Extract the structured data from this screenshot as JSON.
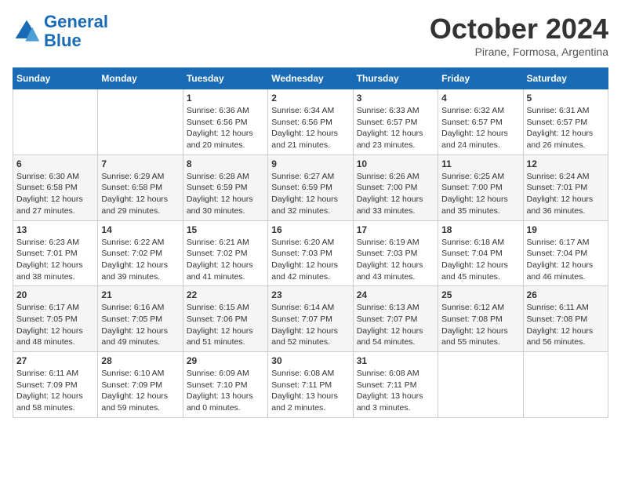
{
  "logo": {
    "line1": "General",
    "line2": "Blue"
  },
  "title": "October 2024",
  "subtitle": "Pirane, Formosa, Argentina",
  "weekdays": [
    "Sunday",
    "Monday",
    "Tuesday",
    "Wednesday",
    "Thursday",
    "Friday",
    "Saturday"
  ],
  "weeks": [
    [
      {
        "day": "",
        "sunrise": "",
        "sunset": "",
        "daylight": ""
      },
      {
        "day": "",
        "sunrise": "",
        "sunset": "",
        "daylight": ""
      },
      {
        "day": "1",
        "sunrise": "Sunrise: 6:36 AM",
        "sunset": "Sunset: 6:56 PM",
        "daylight": "Daylight: 12 hours and 20 minutes."
      },
      {
        "day": "2",
        "sunrise": "Sunrise: 6:34 AM",
        "sunset": "Sunset: 6:56 PM",
        "daylight": "Daylight: 12 hours and 21 minutes."
      },
      {
        "day": "3",
        "sunrise": "Sunrise: 6:33 AM",
        "sunset": "Sunset: 6:57 PM",
        "daylight": "Daylight: 12 hours and 23 minutes."
      },
      {
        "day": "4",
        "sunrise": "Sunrise: 6:32 AM",
        "sunset": "Sunset: 6:57 PM",
        "daylight": "Daylight: 12 hours and 24 minutes."
      },
      {
        "day": "5",
        "sunrise": "Sunrise: 6:31 AM",
        "sunset": "Sunset: 6:57 PM",
        "daylight": "Daylight: 12 hours and 26 minutes."
      }
    ],
    [
      {
        "day": "6",
        "sunrise": "Sunrise: 6:30 AM",
        "sunset": "Sunset: 6:58 PM",
        "daylight": "Daylight: 12 hours and 27 minutes."
      },
      {
        "day": "7",
        "sunrise": "Sunrise: 6:29 AM",
        "sunset": "Sunset: 6:58 PM",
        "daylight": "Daylight: 12 hours and 29 minutes."
      },
      {
        "day": "8",
        "sunrise": "Sunrise: 6:28 AM",
        "sunset": "Sunset: 6:59 PM",
        "daylight": "Daylight: 12 hours and 30 minutes."
      },
      {
        "day": "9",
        "sunrise": "Sunrise: 6:27 AM",
        "sunset": "Sunset: 6:59 PM",
        "daylight": "Daylight: 12 hours and 32 minutes."
      },
      {
        "day": "10",
        "sunrise": "Sunrise: 6:26 AM",
        "sunset": "Sunset: 7:00 PM",
        "daylight": "Daylight: 12 hours and 33 minutes."
      },
      {
        "day": "11",
        "sunrise": "Sunrise: 6:25 AM",
        "sunset": "Sunset: 7:00 PM",
        "daylight": "Daylight: 12 hours and 35 minutes."
      },
      {
        "day": "12",
        "sunrise": "Sunrise: 6:24 AM",
        "sunset": "Sunset: 7:01 PM",
        "daylight": "Daylight: 12 hours and 36 minutes."
      }
    ],
    [
      {
        "day": "13",
        "sunrise": "Sunrise: 6:23 AM",
        "sunset": "Sunset: 7:01 PM",
        "daylight": "Daylight: 12 hours and 38 minutes."
      },
      {
        "day": "14",
        "sunrise": "Sunrise: 6:22 AM",
        "sunset": "Sunset: 7:02 PM",
        "daylight": "Daylight: 12 hours and 39 minutes."
      },
      {
        "day": "15",
        "sunrise": "Sunrise: 6:21 AM",
        "sunset": "Sunset: 7:02 PM",
        "daylight": "Daylight: 12 hours and 41 minutes."
      },
      {
        "day": "16",
        "sunrise": "Sunrise: 6:20 AM",
        "sunset": "Sunset: 7:03 PM",
        "daylight": "Daylight: 12 hours and 42 minutes."
      },
      {
        "day": "17",
        "sunrise": "Sunrise: 6:19 AM",
        "sunset": "Sunset: 7:03 PM",
        "daylight": "Daylight: 12 hours and 43 minutes."
      },
      {
        "day": "18",
        "sunrise": "Sunrise: 6:18 AM",
        "sunset": "Sunset: 7:04 PM",
        "daylight": "Daylight: 12 hours and 45 minutes."
      },
      {
        "day": "19",
        "sunrise": "Sunrise: 6:17 AM",
        "sunset": "Sunset: 7:04 PM",
        "daylight": "Daylight: 12 hours and 46 minutes."
      }
    ],
    [
      {
        "day": "20",
        "sunrise": "Sunrise: 6:17 AM",
        "sunset": "Sunset: 7:05 PM",
        "daylight": "Daylight: 12 hours and 48 minutes."
      },
      {
        "day": "21",
        "sunrise": "Sunrise: 6:16 AM",
        "sunset": "Sunset: 7:05 PM",
        "daylight": "Daylight: 12 hours and 49 minutes."
      },
      {
        "day": "22",
        "sunrise": "Sunrise: 6:15 AM",
        "sunset": "Sunset: 7:06 PM",
        "daylight": "Daylight: 12 hours and 51 minutes."
      },
      {
        "day": "23",
        "sunrise": "Sunrise: 6:14 AM",
        "sunset": "Sunset: 7:07 PM",
        "daylight": "Daylight: 12 hours and 52 minutes."
      },
      {
        "day": "24",
        "sunrise": "Sunrise: 6:13 AM",
        "sunset": "Sunset: 7:07 PM",
        "daylight": "Daylight: 12 hours and 54 minutes."
      },
      {
        "day": "25",
        "sunrise": "Sunrise: 6:12 AM",
        "sunset": "Sunset: 7:08 PM",
        "daylight": "Daylight: 12 hours and 55 minutes."
      },
      {
        "day": "26",
        "sunrise": "Sunrise: 6:11 AM",
        "sunset": "Sunset: 7:08 PM",
        "daylight": "Daylight: 12 hours and 56 minutes."
      }
    ],
    [
      {
        "day": "27",
        "sunrise": "Sunrise: 6:11 AM",
        "sunset": "Sunset: 7:09 PM",
        "daylight": "Daylight: 12 hours and 58 minutes."
      },
      {
        "day": "28",
        "sunrise": "Sunrise: 6:10 AM",
        "sunset": "Sunset: 7:09 PM",
        "daylight": "Daylight: 12 hours and 59 minutes."
      },
      {
        "day": "29",
        "sunrise": "Sunrise: 6:09 AM",
        "sunset": "Sunset: 7:10 PM",
        "daylight": "Daylight: 13 hours and 0 minutes."
      },
      {
        "day": "30",
        "sunrise": "Sunrise: 6:08 AM",
        "sunset": "Sunset: 7:11 PM",
        "daylight": "Daylight: 13 hours and 2 minutes."
      },
      {
        "day": "31",
        "sunrise": "Sunrise: 6:08 AM",
        "sunset": "Sunset: 7:11 PM",
        "daylight": "Daylight: 13 hours and 3 minutes."
      },
      {
        "day": "",
        "sunrise": "",
        "sunset": "",
        "daylight": ""
      },
      {
        "day": "",
        "sunrise": "",
        "sunset": "",
        "daylight": ""
      }
    ]
  ]
}
